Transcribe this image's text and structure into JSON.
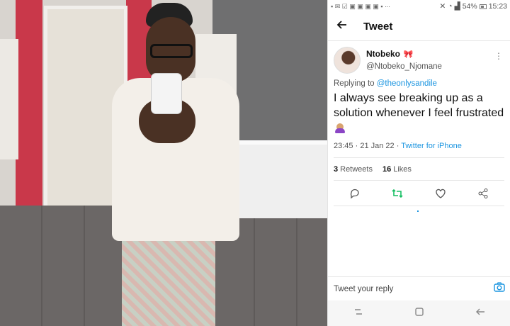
{
  "status_bar": {
    "icons": [
      "message-icon",
      "wifi-call-icon",
      "box-icon",
      "app-icons"
    ],
    "battery": "54%",
    "time": "15:23"
  },
  "header": {
    "title": "Tweet"
  },
  "tweet": {
    "display_name": "Ntobeko",
    "name_emoji": "🎀",
    "handle": "@Ntobeko_Njomane",
    "replying_prefix": "Replying to",
    "replying_to": "@theonlysandile",
    "text": "I always see breaking up as a solution whenever I feel frustrated",
    "emoji_icon": "woman-with-crown-icon",
    "time": "23:45",
    "date": "21 Jan 22",
    "source": "Twitter for iPhone",
    "meta_sep": "·",
    "retweets_count": "3",
    "retweets_label": "Retweets",
    "likes_count": "16",
    "likes_label": "Likes"
  },
  "reply_bar": {
    "placeholder": "Tweet your reply"
  },
  "colors": {
    "accent": "#1b95e0",
    "retweet": "#17bf63"
  }
}
